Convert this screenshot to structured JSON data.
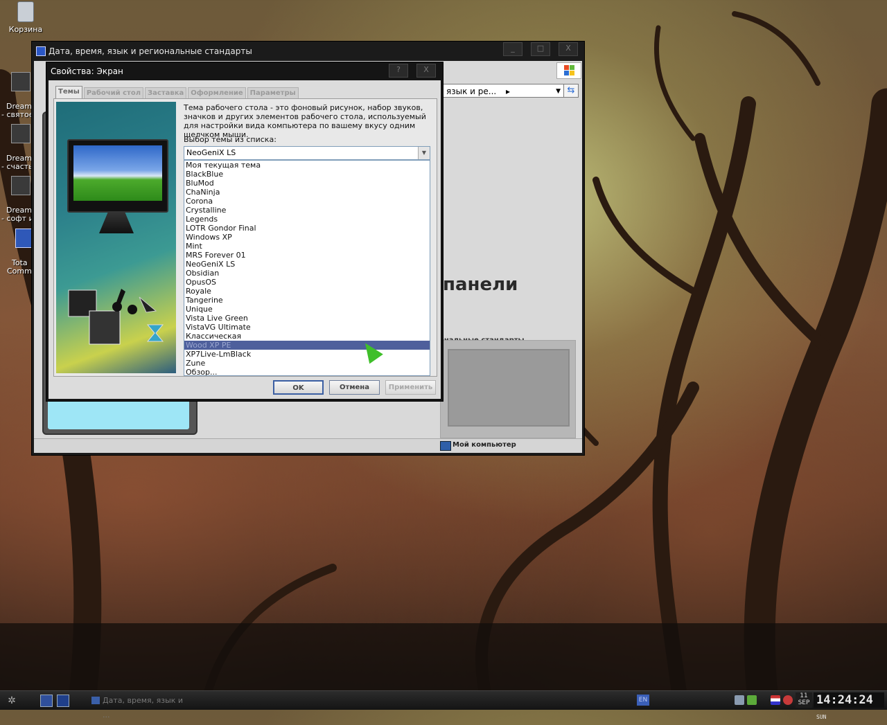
{
  "desktop": {
    "icons": [
      {
        "label": "Корзина"
      },
      {
        "label": "DreamLa\n- святое"
      },
      {
        "label": "DreamLa\n- счасть"
      },
      {
        "label": "DreamPr\n- софт и"
      },
      {
        "label": "Tota\nComma"
      }
    ]
  },
  "outer_window": {
    "title": "Дата, время, язык и региональные стандарты",
    "address_text": "язык и ре...",
    "heading": "панели",
    "category_label": "ональные стандарты",
    "status_text": "Мой компьютер",
    "minimize": "_",
    "maximize": "□",
    "close": "X"
  },
  "dialog": {
    "title": "Свойства: Экран",
    "help": "?",
    "close": "X",
    "tabs": [
      "Темы",
      "Рабочий стол",
      "Заставка",
      "Оформление",
      "Параметры"
    ],
    "description": "Тема рабочего стола - это фоновый рисунок, набор звуков, значков и других элементов рабочего стола, используемый для настройки вида компьютера по вашему вкусу одним щелчком мыши.",
    "list_label": "Выбор темы из списка:",
    "selected_theme": "NeoGeniX LS",
    "themes": [
      "Моя текущая тема",
      "BlackBlue",
      "BluMod",
      "ChaNinja",
      "Corona",
      "Crystalline",
      "Legends",
      "LOTR Gondor Final",
      "Windows XP",
      "Mint",
      "MRS Forever 01",
      "NeoGeniX LS",
      "Obsidian",
      "OpusOS",
      "Royale",
      "Tangerine",
      "Unique",
      "Vista Live Green",
      "VistaVG Ultimate",
      "Классическая",
      "Wood XP PE",
      "XP7Live-LmBlack",
      "Zune",
      "Обзор..."
    ],
    "highlighted_index": 20,
    "buttons": {
      "ok": "OK",
      "cancel": "Отмена",
      "apply": "Применить"
    }
  },
  "taskbar": {
    "task_label": "Дата, время, язык и ...",
    "language": "EN",
    "date_day": "11",
    "date_month": "SEP",
    "time": "14:24:24",
    "weekday": "SUN"
  },
  "colors": {
    "selection": "#4e5f9c",
    "window_frame": "#151515",
    "cursor": "#3fbf2a"
  }
}
